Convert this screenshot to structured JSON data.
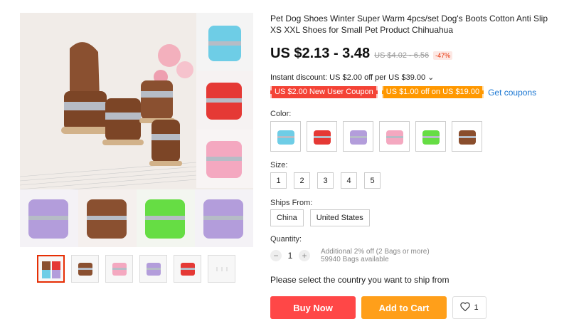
{
  "product": {
    "title": "Pet Dog Shoes Winter Super Warm 4pcs/set Dog's Boots Cotton Anti Slip XS XXL Shoes for Small Pet Product Chihuahua",
    "price": "US $2.13 - 3.48",
    "old_price": "US $4.02 - 6.56",
    "discount": "-47%"
  },
  "instant_discount": "Instant discount: US $2.00 off per US $39.00 ⌄",
  "coupons": [
    {
      "label": "US $2.00 New User Coupon",
      "color": "#f44336"
    },
    {
      "label": "US $1.00 off on US $19.00",
      "color": "#ff9800"
    }
  ],
  "get_coupons": "Get coupons",
  "color_label": "Color:",
  "colors": [
    "#6ecde6",
    "#e53935",
    "#b39ddb",
    "#f4a8c0",
    "#66dd44",
    "#8a4e2d"
  ],
  "size_label": "Size:",
  "sizes": [
    "1",
    "2",
    "3",
    "4",
    "5"
  ],
  "ships_label": "Ships From:",
  "ships_from": [
    "China",
    "United States"
  ],
  "quantity": {
    "label": "Quantity:",
    "value": "1",
    "minus": "−",
    "plus": "+",
    "note1": "Additional 2% off (2 Bags or more)",
    "note2": "59940 Bags available"
  },
  "ship_notice": "Please select the country you want to ship from",
  "buttons": {
    "buy_now": "Buy Now",
    "add_to_cart": "Add to Cart",
    "wishlist_count": "1"
  },
  "thumbnails": [
    "mixed",
    "brown",
    "pink",
    "purple",
    "red",
    "blank"
  ]
}
